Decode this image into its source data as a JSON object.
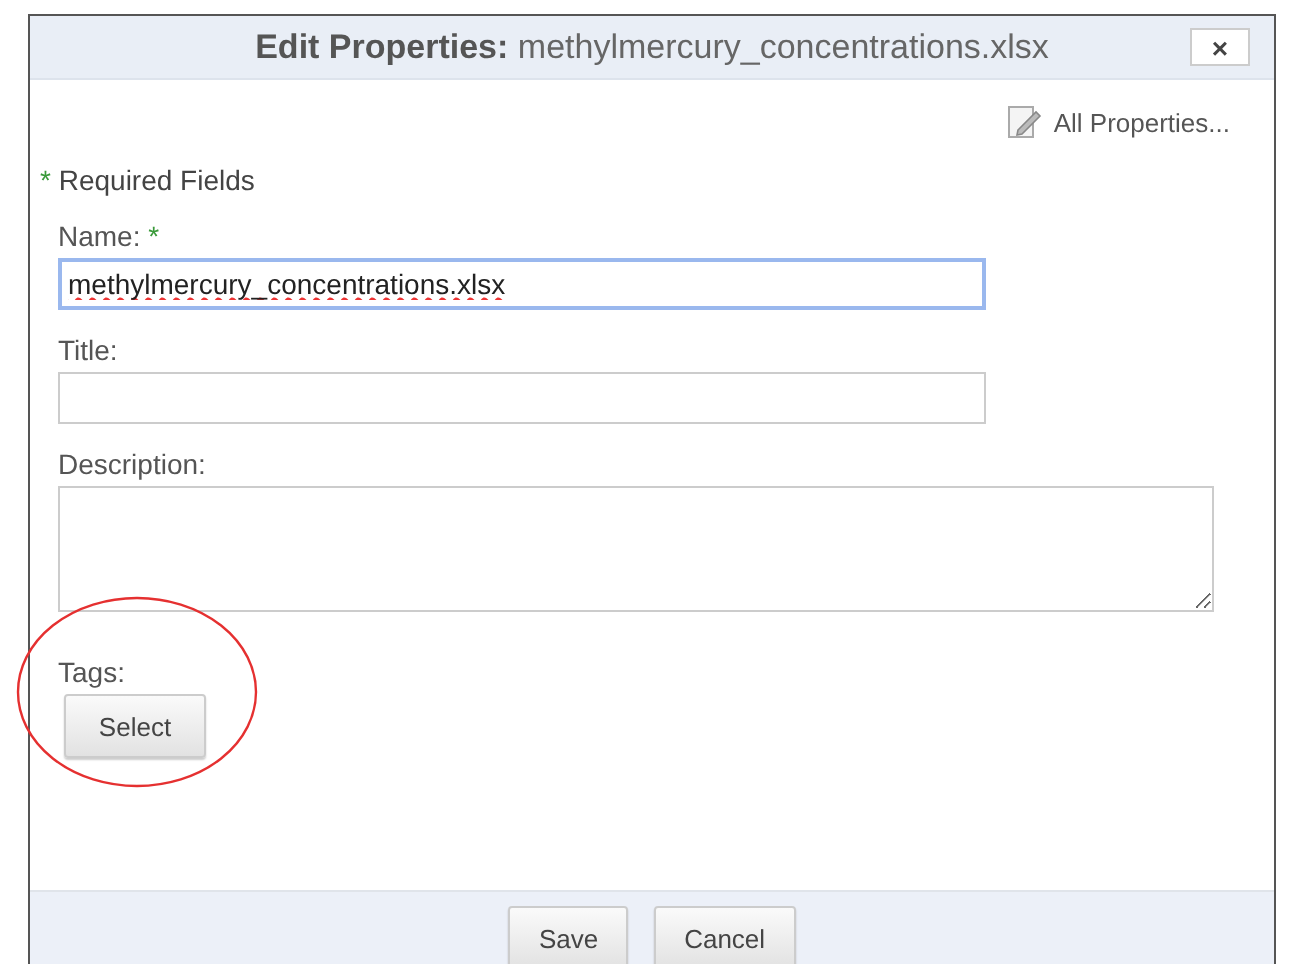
{
  "dialog": {
    "title_label": "Edit Properties:",
    "title_file": "methylmercury_concentrations.xlsx",
    "close": "×"
  },
  "all_properties_link": "All Properties...",
  "required_note": {
    "marker": "*",
    "text": "Required Fields"
  },
  "fields": [
    {
      "kind": "text",
      "label": "Name:",
      "required_marker": "*",
      "value": "methylmercury_concentrations.xlsx",
      "focused": true
    },
    {
      "kind": "text",
      "label": "Title:",
      "focused": false
    },
    {
      "kind": "textarea",
      "label": "Description:",
      "focused": false
    }
  ],
  "tags": {
    "label": "Tags:",
    "button": "Select",
    "highlighted": true
  },
  "buttons": [
    "Save",
    "Cancel"
  ]
}
